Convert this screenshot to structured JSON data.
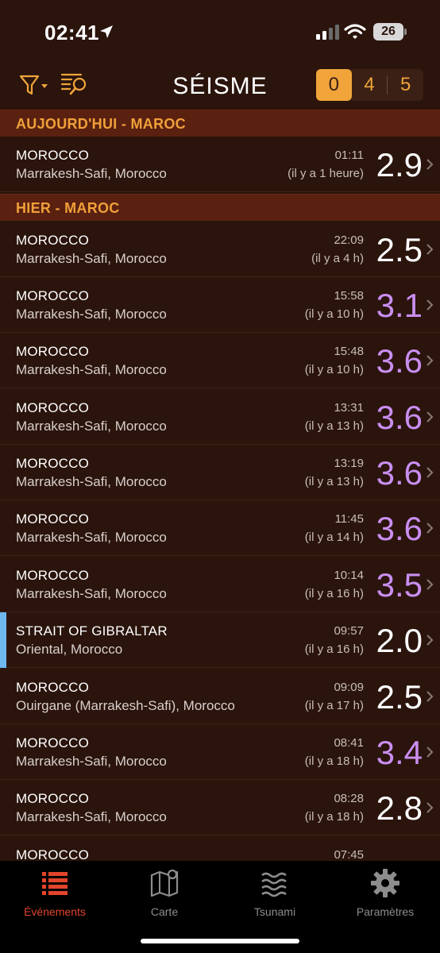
{
  "status": {
    "time": "02:41",
    "battery": "26"
  },
  "nav": {
    "title": "SÉISME",
    "counts": [
      "0",
      "4",
      "5"
    ]
  },
  "sections": [
    {
      "header": "AUJOURD'HUI - MAROC",
      "rows": [
        {
          "title": "MOROCCO",
          "place": "Marrakesh-Safi, Morocco",
          "time": "01:11",
          "ago": "(il y a 1 heure)",
          "mag": "2.9",
          "color": "white"
        }
      ]
    },
    {
      "header": "HIER - MAROC",
      "rows": [
        {
          "title": "MOROCCO",
          "place": "Marrakesh-Safi, Morocco",
          "time": "22:09",
          "ago": "(il y a 4 h)",
          "mag": "2.5",
          "color": "white"
        },
        {
          "title": "MOROCCO",
          "place": "Marrakesh-Safi, Morocco",
          "time": "15:58",
          "ago": "(il y a 10 h)",
          "mag": "3.1",
          "color": "purple"
        },
        {
          "title": "MOROCCO",
          "place": "Marrakesh-Safi, Morocco",
          "time": "15:48",
          "ago": "(il y a 10 h)",
          "mag": "3.6",
          "color": "purple"
        },
        {
          "title": "MOROCCO",
          "place": "Marrakesh-Safi, Morocco",
          "time": "13:31",
          "ago": "(il y a 13 h)",
          "mag": "3.6",
          "color": "purple"
        },
        {
          "title": "MOROCCO",
          "place": "Marrakesh-Safi, Morocco",
          "time": "13:19",
          "ago": "(il y a 13 h)",
          "mag": "3.6",
          "color": "purple"
        },
        {
          "title": "MOROCCO",
          "place": "Marrakesh-Safi, Morocco",
          "time": "11:45",
          "ago": "(il y a 14 h)",
          "mag": "3.6",
          "color": "purple"
        },
        {
          "title": "MOROCCO",
          "place": "Marrakesh-Safi, Morocco",
          "time": "10:14",
          "ago": "(il y a 16 h)",
          "mag": "3.5",
          "color": "purple"
        },
        {
          "title": "STRAIT OF GIBRALTAR",
          "place": "Oriental, Morocco",
          "time": "09:57",
          "ago": "(il y a 16 h)",
          "mag": "2.0",
          "color": "white",
          "accent": true
        },
        {
          "title": "MOROCCO",
          "place": "Ouirgane (Marrakesh-Safi), Morocco",
          "time": "09:09",
          "ago": "(il y a 17 h)",
          "mag": "2.5",
          "color": "white"
        },
        {
          "title": "MOROCCO",
          "place": "Marrakesh-Safi, Morocco",
          "time": "08:41",
          "ago": "(il y a 18 h)",
          "mag": "3.4",
          "color": "purple"
        },
        {
          "title": "MOROCCO",
          "place": "Marrakesh-Safi, Morocco",
          "time": "08:28",
          "ago": "(il y a 18 h)",
          "mag": "2.8",
          "color": "white"
        },
        {
          "title": "MOROCCO",
          "place": "",
          "time": "07:45",
          "ago": "",
          "mag": "",
          "color": "white"
        }
      ]
    }
  ],
  "tabs": [
    {
      "label": "Événements",
      "icon": "list-icon",
      "active": true
    },
    {
      "label": "Carte",
      "icon": "map-icon",
      "active": false
    },
    {
      "label": "Tsunami",
      "icon": "waves-icon",
      "active": false
    },
    {
      "label": "Paramètres",
      "icon": "gear-icon",
      "active": false
    }
  ],
  "colors": {
    "accent": "#f0a43a",
    "purple": "#c98ef0",
    "tab_active": "#e2452b",
    "marker": "#6fb7ef"
  }
}
